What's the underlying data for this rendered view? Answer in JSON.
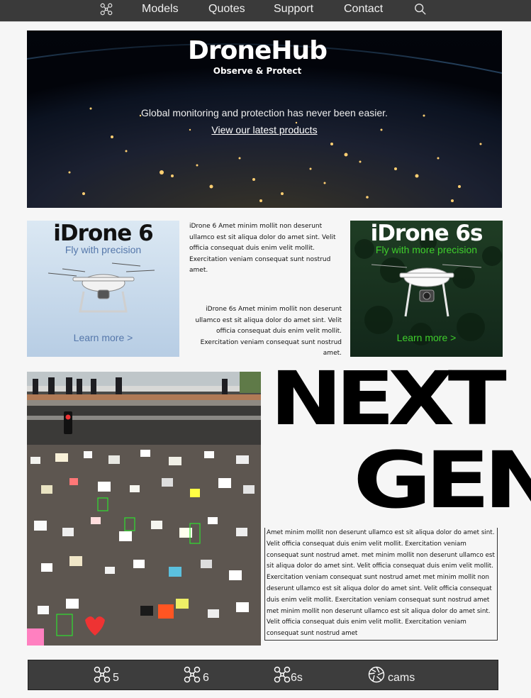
{
  "nav": {
    "logo_icon": "drone-icon",
    "links": [
      "Models",
      "Quotes",
      "Support",
      "Contact"
    ],
    "search_icon": "search-icon"
  },
  "hero": {
    "title": "DroneHub",
    "subtitle": "Observe & Protect",
    "tagline": "Global monitoring and protection has never been easier.",
    "cta": "View our latest products"
  },
  "products": [
    {
      "title": "iDrone 6",
      "tagline": "Fly with precision",
      "link": "Learn more >",
      "description": "iDrone 6 Amet minim mollit non deserunt ullamco est sit aliqua dolor do amet sint. Velit officia consequat duis enim velit mollit. Exercitation veniam consequat sunt nostrud amet."
    },
    {
      "title": "iDrone 6s",
      "tagline": "Fly with more precision",
      "link": "Learn more >",
      "description": "iDrone 6s Amet minim mollit non deserunt ullamco est sit aliqua dolor do amet sint. Velit officia consequat duis enim velit mollit. Exercitation veniam consequat sunt nostrud amet."
    }
  ],
  "feature": {
    "heading_line1": "NEXT",
    "heading_line2": "GEN",
    "body": "Amet minim mollit non deserunt ullamco est sit aliqua dolor do amet sint. Velit officia consequat duis enim velit mollit. Exercitation veniam consequat sunt nostrud amet. met minim mollit non deserunt ullamco est sit aliqua dolor do amet sint. Velit officia consequat duis enim velit mollit. Exercitation veniam consequat sunt nostrud amet met minim mollit non deserunt ullamco est sit aliqua dolor do amet sint. Velit officia consequat duis enim velit mollit. Exercitation veniam consequat sunt nostrud amet met minim mollit non deserunt ullamco est sit aliqua dolor do amet sint. Velit officia consequat duis enim velit mollit. Exercitation veniam consequat sunt nostrud amet"
  },
  "bottom_nav": [
    {
      "icon": "drone-icon",
      "label": "5"
    },
    {
      "icon": "drone-icon",
      "label": "6"
    },
    {
      "icon": "drone-icon",
      "label": "6s"
    },
    {
      "icon": "camera-shutter-icon",
      "label": "cams"
    }
  ],
  "colors": {
    "nav_bg": "#3a3a3a",
    "accent_blue": "#5577aa",
    "accent_green": "#3fcf2c",
    "page_bg": "#f6f6f6"
  }
}
